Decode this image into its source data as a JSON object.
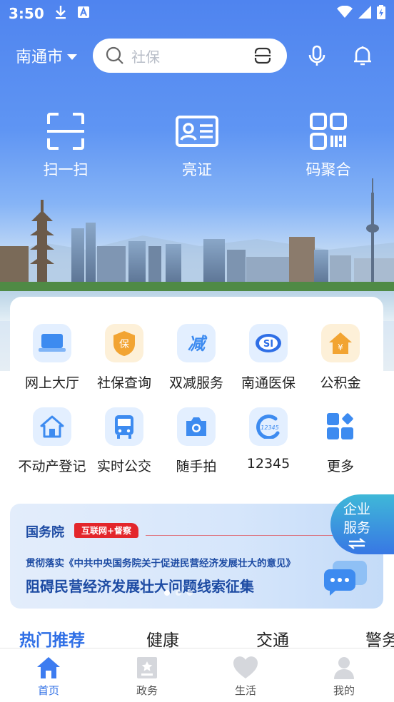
{
  "status_bar": {
    "time": "3:50"
  },
  "header": {
    "city": "南通市",
    "search_placeholder": "社保"
  },
  "quick_actions": [
    {
      "label": "扫一扫",
      "icon": "scan-icon"
    },
    {
      "label": "亮证",
      "icon": "id-card-icon"
    },
    {
      "label": "码聚合",
      "icon": "qr-grid-icon"
    }
  ],
  "services": [
    {
      "label": "网上大厅",
      "icon": "laptop-icon"
    },
    {
      "label": "社保查询",
      "icon": "insurance-shield-icon"
    },
    {
      "label": "双减服务",
      "icon": "reduce-icon"
    },
    {
      "label": "南通医保",
      "icon": "medical-insurance-icon"
    },
    {
      "label": "公积金",
      "icon": "housing-fund-icon"
    },
    {
      "label": "不动产登记",
      "icon": "house-icon"
    },
    {
      "label": "实时公交",
      "icon": "bus-icon"
    },
    {
      "label": "随手拍",
      "icon": "camera-icon"
    },
    {
      "label": "12345",
      "icon": "hotline-icon"
    },
    {
      "label": "更多",
      "icon": "more-grid-icon"
    }
  ],
  "banner": {
    "org": "国务院",
    "tag": "互联网+督察",
    "subtitle": "贯彻落实《中共中央国务院关于促进民营经济发展壮大的意见》",
    "title": "阻碍民营经济发展壮大问题线索征集"
  },
  "enterprise_button": {
    "line1": "企业",
    "line2": "服务"
  },
  "hot_tabs": [
    "热门推荐",
    "健康",
    "交通",
    "警务"
  ],
  "bottom_nav": [
    {
      "label": "首页",
      "icon": "home-icon",
      "active": true
    },
    {
      "label": "政务",
      "icon": "government-icon",
      "active": false
    },
    {
      "label": "生活",
      "icon": "heart-icon",
      "active": false
    },
    {
      "label": "我的",
      "icon": "user-icon",
      "active": false
    }
  ],
  "colors": {
    "primary": "#2f6fe6",
    "banner_red": "#e3262b"
  }
}
